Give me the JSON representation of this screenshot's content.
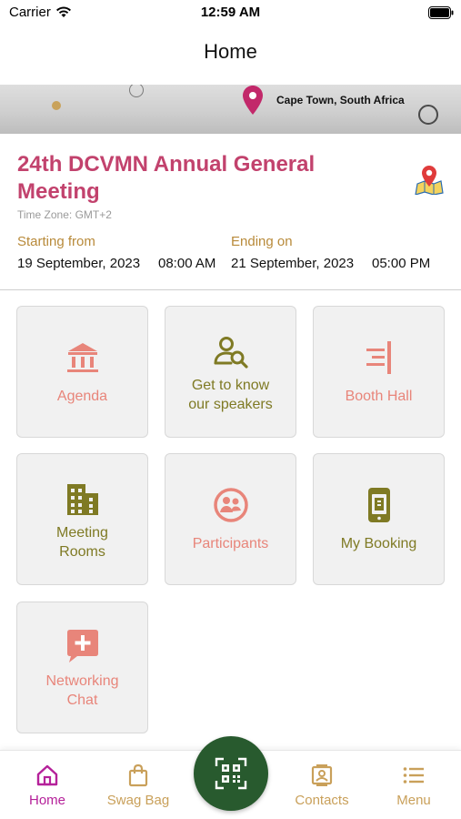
{
  "status_bar": {
    "carrier": "Carrier",
    "time": "12:59 AM"
  },
  "nav": {
    "title": "Home"
  },
  "banner": {
    "location": "Cape Town, South Africa"
  },
  "event": {
    "title": "24th DCVMN Annual General Meeting",
    "timezone": "Time Zone: GMT+2",
    "start_label": "Starting from",
    "start_date": "19 September, 2023",
    "start_time": "08:00 AM",
    "end_label": "Ending on",
    "end_date": "21 September, 2023",
    "end_time": "05:00 PM"
  },
  "tiles": [
    {
      "line1": "Agenda",
      "line2": "",
      "icon": "bank-icon"
    },
    {
      "line1": "Get to know",
      "line2": "our speakers",
      "icon": "user-search-icon"
    },
    {
      "line1": "Booth Hall",
      "line2": "",
      "icon": "booth-icon"
    },
    {
      "line1": "Meeting",
      "line2": "Rooms",
      "icon": "building-icon"
    },
    {
      "line1": "Participants",
      "line2": "",
      "icon": "participants-icon"
    },
    {
      "line1": "My Booking",
      "line2": "",
      "icon": "booking-icon"
    },
    {
      "line1": "Networking",
      "line2": "Chat",
      "icon": "chat-plus-icon"
    }
  ],
  "tabbar": {
    "home": "Home",
    "swag": "Swag Bag",
    "contacts": "Contacts",
    "menu": "Menu"
  },
  "colors": {
    "title": "#c2426d",
    "accent_gold": "#b88a3a",
    "tile_pink": "#e8857a",
    "tile_olive": "#7f7a24",
    "qr_green": "#285a2e",
    "home_active": "#b5219a"
  }
}
